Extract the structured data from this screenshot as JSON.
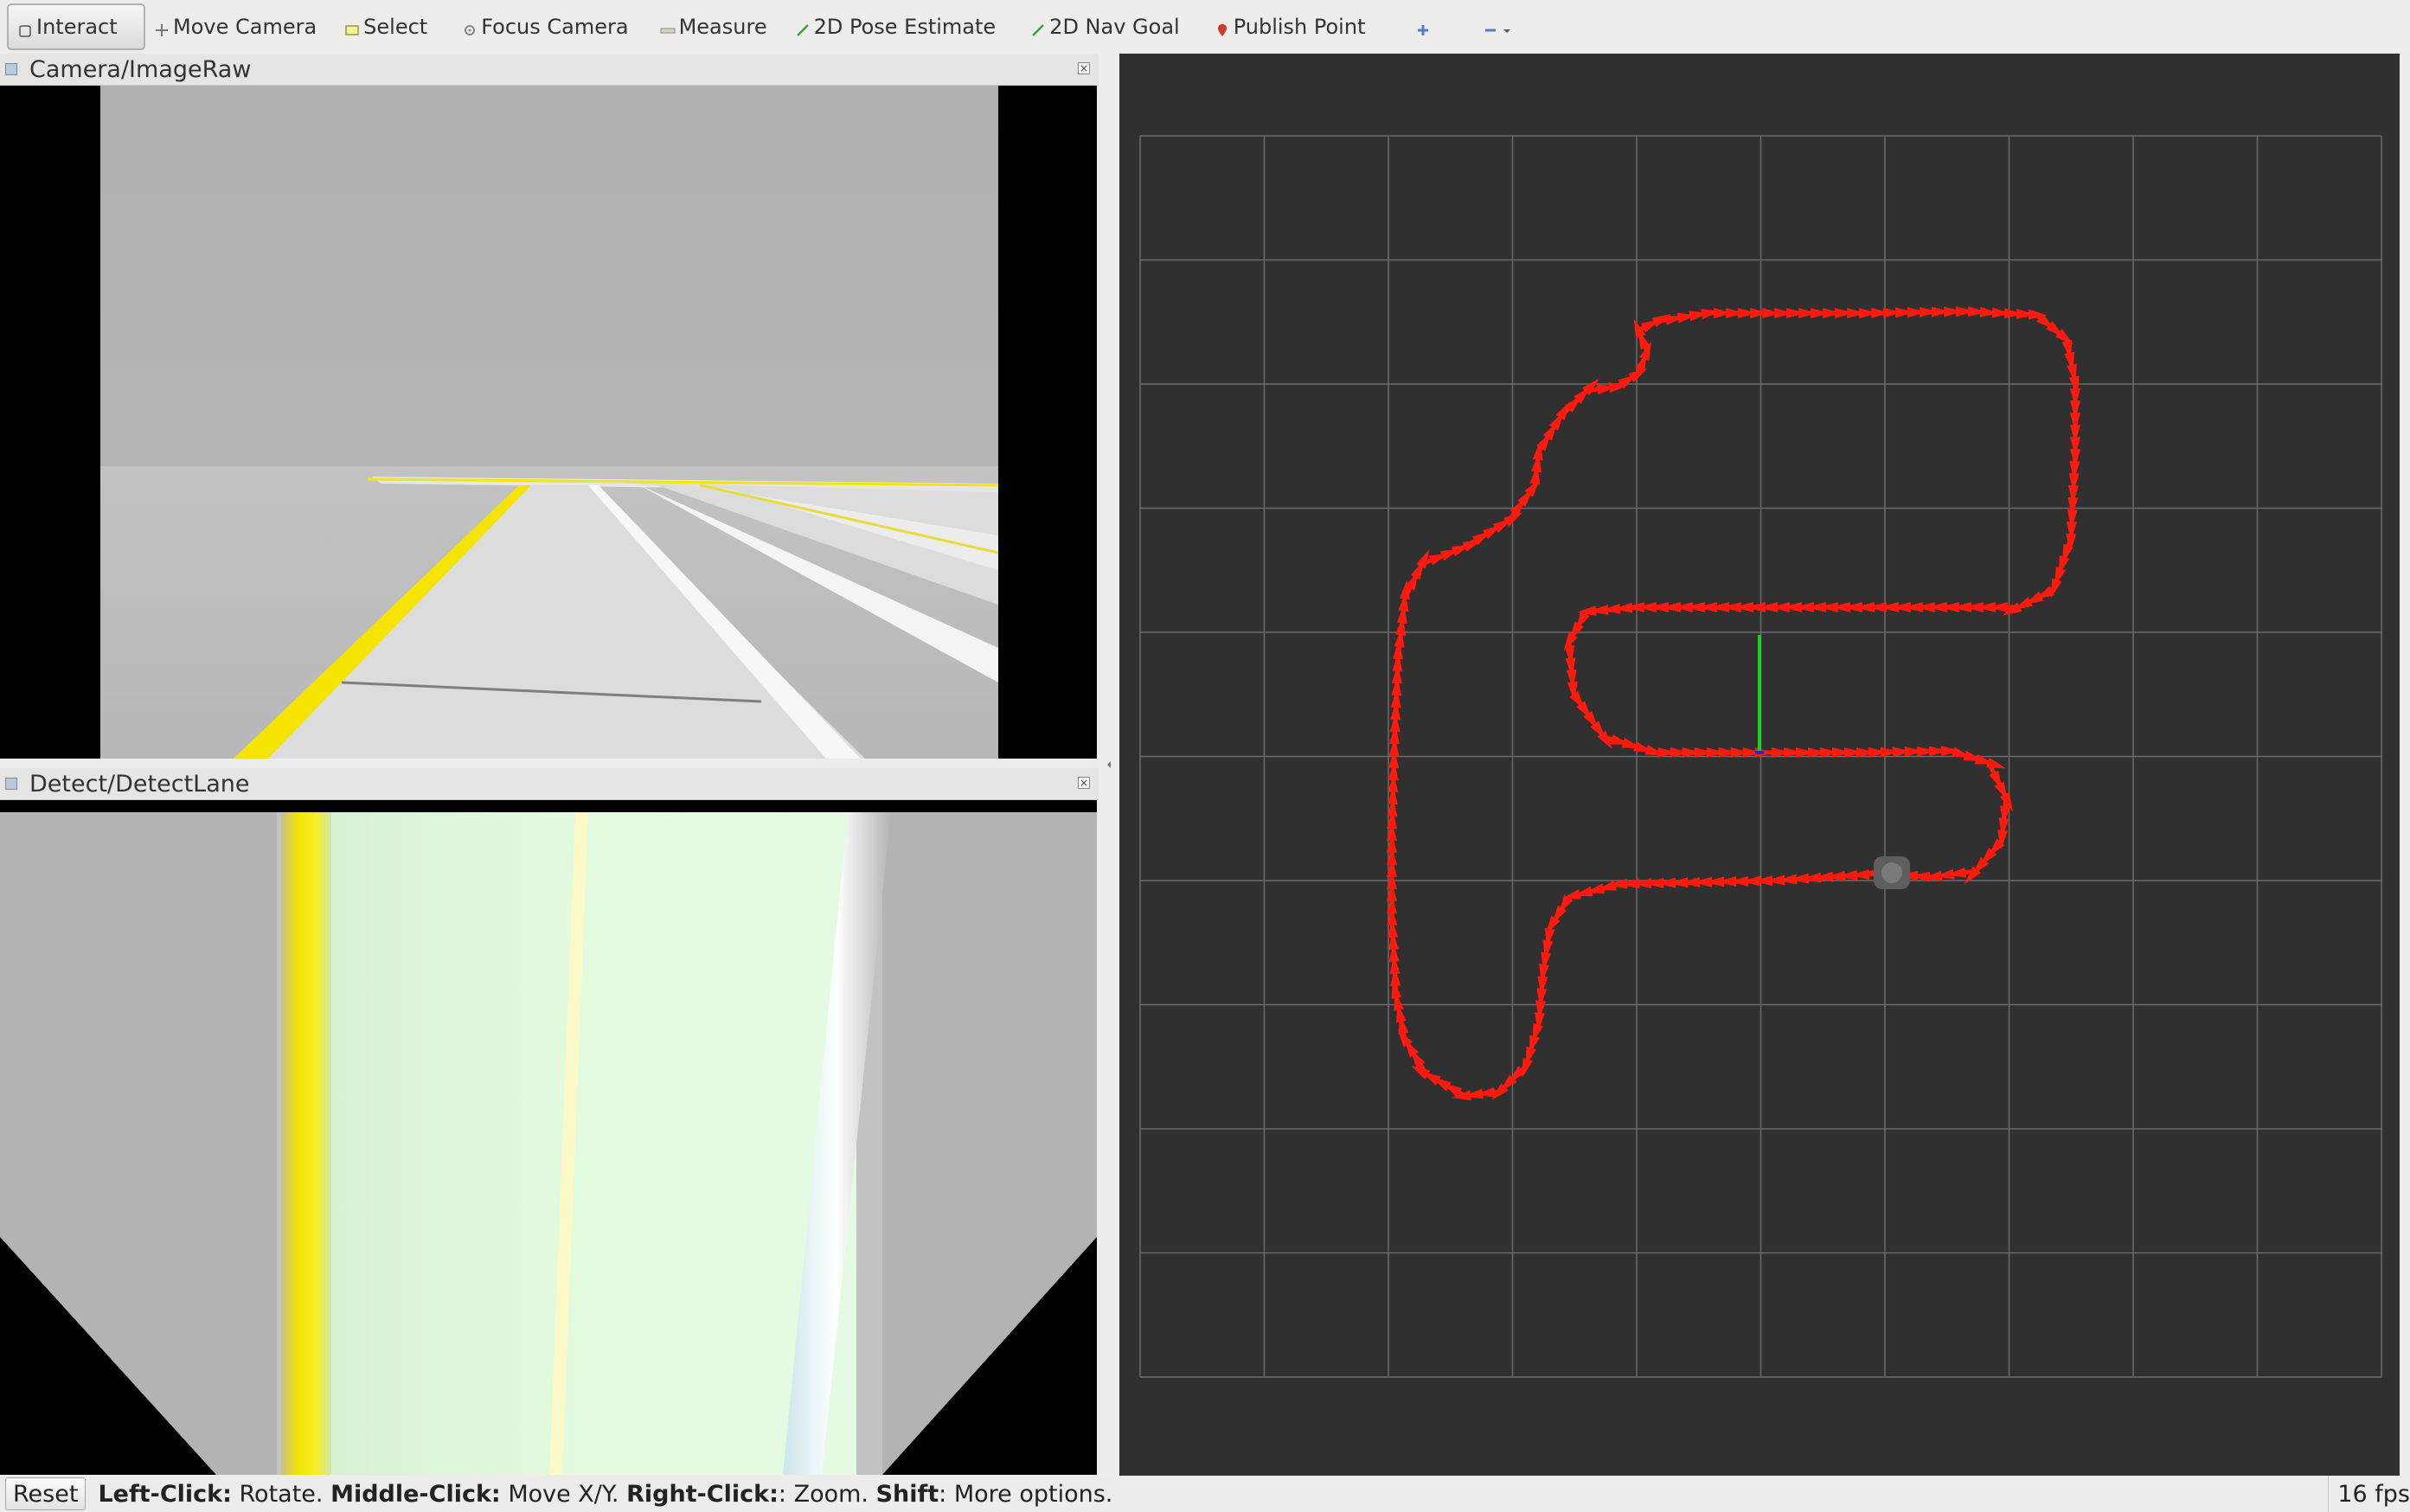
{
  "toolbar": {
    "tools": [
      {
        "label": "Interact",
        "icon": "interact-icon"
      },
      {
        "label": "Move Camera",
        "icon": "move-camera-icon"
      },
      {
        "label": "Select",
        "icon": "select-icon"
      },
      {
        "label": "Focus Camera",
        "icon": "focus-camera-icon"
      },
      {
        "label": "Measure",
        "icon": "measure-icon"
      },
      {
        "label": "2D Pose Estimate",
        "icon": "pose-estimate-icon"
      },
      {
        "label": "2D Nav Goal",
        "icon": "nav-goal-icon"
      },
      {
        "label": "Publish Point",
        "icon": "publish-point-icon"
      }
    ],
    "active_tool": "Interact"
  },
  "panels": {
    "camera": {
      "title": "Camera/ImageRaw"
    },
    "detect": {
      "title": "Detect/DetectLane"
    }
  },
  "status": {
    "reset_label": "Reset",
    "hints": [
      {
        "key": "Left-Click:",
        "text": "Rotate."
      },
      {
        "key": "Middle-Click:",
        "text": "Move X/Y."
      },
      {
        "key": "Right-Click:",
        "text": ": Zoom."
      },
      {
        "key": "Shift",
        "text": ": More options."
      }
    ],
    "fps": "16 fps"
  },
  "colors": {
    "lane_yellow": "#f5e400",
    "path_red": "#ff1a0d",
    "axis_green": "#1bd11b",
    "grid_line": "#6a6a6a",
    "rviz_bg": "#303030"
  }
}
